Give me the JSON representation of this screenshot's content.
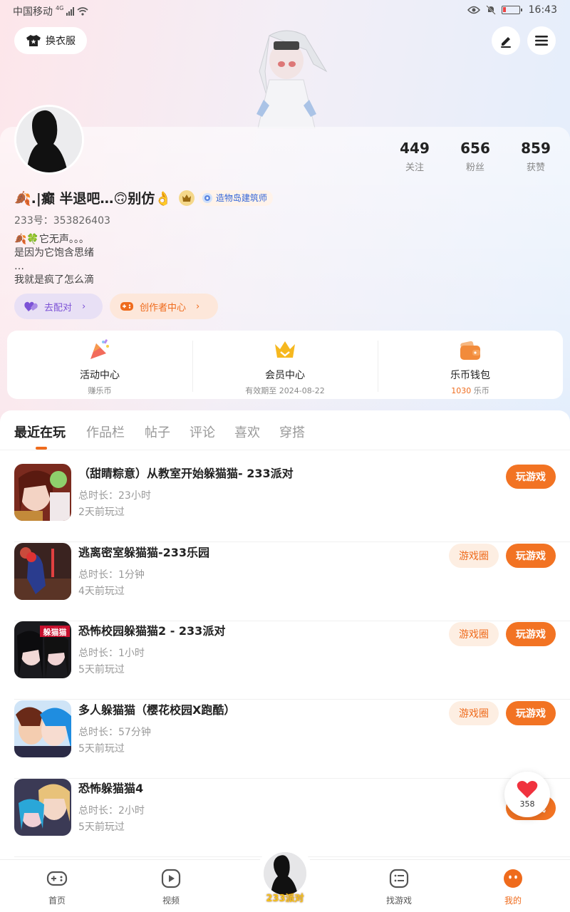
{
  "status_bar": {
    "carrier": "中国移动",
    "network": "4G",
    "time": "16:43"
  },
  "header": {
    "outfit_label": "换衣服",
    "edit_icon": "pen-icon",
    "menu_icon": "menu-icon"
  },
  "profile": {
    "stats": [
      {
        "value": "449",
        "label": "关注"
      },
      {
        "value": "656",
        "label": "粉丝"
      },
      {
        "value": "859",
        "label": "获赞"
      }
    ],
    "nickname": "🍂.|癫 半退吧…🙃别仿👌",
    "builder_badge": "造物岛建筑师",
    "uid": "233号：353826403",
    "bio": [
      "🍂🍀它无声。。。",
      "是因为它饱含思绪",
      "…",
      "我就是疯了怎么滴"
    ],
    "match_label": "去配对",
    "creator_label": "创作者中心"
  },
  "quick": [
    {
      "title": "活动中心",
      "sub": "赚乐币"
    },
    {
      "title": "会员中心",
      "sub": "有效期至 2024-08-22"
    },
    {
      "title": "乐币钱包",
      "sub_value": "1030",
      "sub_unit": " 乐币"
    }
  ],
  "tabs": [
    "最近在玩",
    "作品栏",
    "帖子",
    "评论",
    "喜欢",
    "穿搭"
  ],
  "games": [
    {
      "title": "（甜睛粽意）从教室开始躲猫猫- 233派对",
      "duration": "总时长：23小时",
      "last": "2天前玩过",
      "circle": ""
    },
    {
      "title": "逃离密室躲猫猫-233乐园",
      "duration": "总时长：1分钟",
      "last": "4天前玩过",
      "circle": "游戏圈"
    },
    {
      "title": "恐怖校园躲猫猫2 - 233派对",
      "duration": "总时长：1小时",
      "last": "5天前玩过",
      "circle": "游戏圈"
    },
    {
      "title": "多人躲猫猫（樱花校园X跑酷）",
      "duration": "总时长：57分钟",
      "last": "5天前玩过",
      "circle": "游戏圈"
    },
    {
      "title": "恐怖躲猫猫4",
      "duration": "总时长：2小时",
      "last": "5天前玩过",
      "circle": ""
    }
  ],
  "play_label": "玩游戏",
  "thumb3_text": "躲猫猫",
  "like_count": "358",
  "nav": {
    "home": "首页",
    "video": "视频",
    "party": "233派对",
    "find": "找游戏",
    "mine": "我的"
  },
  "colors": {
    "accent": "#ef6b1c",
    "purple": "#7c52d6",
    "badge_blue": "#3466d8"
  }
}
